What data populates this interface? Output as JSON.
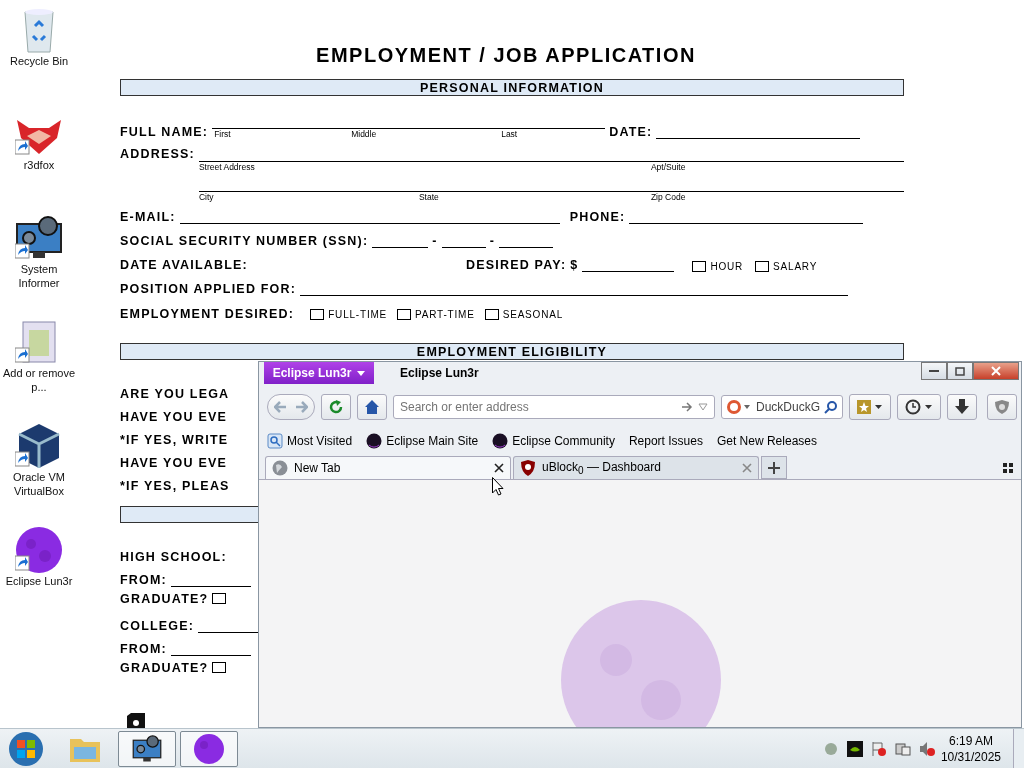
{
  "desktop_icons": [
    {
      "label": "Recycle Bin",
      "kind": "recycle",
      "shortcut": false
    },
    {
      "label": "r3dfox",
      "kind": "fox",
      "shortcut": true
    },
    {
      "label": "System Informer",
      "kind": "monitor",
      "shortcut": true
    },
    {
      "label": "Add or remove p...",
      "kind": "installer",
      "shortcut": true
    },
    {
      "label": "Oracle VM VirtualBox",
      "kind": "cube",
      "shortcut": true
    },
    {
      "label": "Eclipse Lun3r",
      "kind": "moon",
      "shortcut": true
    }
  ],
  "document": {
    "title": "EMPLOYMENT / JOB APPLICATION",
    "personal": {
      "heading": "PERSONAL INFORMATION",
      "full_name_label": "FULL NAME:",
      "name_hints": [
        "First",
        "Middle",
        "Last"
      ],
      "date_label": "DATE:",
      "address_label": "ADDRESS:",
      "address_hints": [
        "Street Address",
        "Apt/Suite"
      ],
      "address_hints_2": [
        "City",
        "State",
        "Zip Code"
      ],
      "email_label": "E-MAIL:",
      "phone_label": "PHONE:",
      "ssn_label": "SOCIAL SECURITY NUMBER (SSN):",
      "ssn_separators": [
        "-",
        "-"
      ],
      "date_available_label": "DATE AVAILABLE:",
      "desired_pay_label": "DESIRED PAY:",
      "currency": "$",
      "pay_options": [
        {
          "label": "HOUR",
          "checked": false
        },
        {
          "label": "SALARY",
          "checked": false
        }
      ],
      "position_label": "POSITION APPLIED FOR:",
      "employment_desired_label": "EMPLOYMENT DESIRED:",
      "employment_options": [
        {
          "label": "FULL-TIME",
          "checked": false
        },
        {
          "label": "PART-TIME",
          "checked": false
        },
        {
          "label": "SEASONAL",
          "checked": false
        }
      ]
    },
    "eligibility": {
      "heading": "EMPLOYMENT ELIGIBILITY",
      "questions": [
        "ARE YOU LEGA",
        "HAVE YOU EVE",
        "*IF YES, WRITE",
        "HAVE YOU EVE",
        "*IF YES, PLEAS"
      ]
    },
    "education": {
      "rows": [
        {
          "kind": "label",
          "label": "HIGH SCHOOL:"
        },
        {
          "kind": "line",
          "label": "FROM:"
        },
        {
          "kind": "check",
          "label": "GRADUATE?",
          "checked": false
        },
        {
          "kind": "line",
          "label": "COLLEGE:"
        },
        {
          "kind": "line",
          "label": "FROM:"
        },
        {
          "kind": "check",
          "label": "GRADUATE?",
          "checked": false
        }
      ]
    }
  },
  "browser": {
    "menu_button": "Eclipse Lun3r",
    "title": "Eclipse Lun3r",
    "address_placeholder": "Search or enter address",
    "search_text": "DuckDuckG",
    "bookmarks": [
      {
        "label": "Most Visited",
        "kind": "folder"
      },
      {
        "label": "Eclipse Main Site",
        "kind": "eclipse"
      },
      {
        "label": "Eclipse Community",
        "kind": "eclipse"
      },
      {
        "label": "Report Issues",
        "kind": "plain"
      },
      {
        "label": "Get New Releases",
        "kind": "plain"
      }
    ],
    "tabs": [
      {
        "label": "New Tab",
        "kind": "globe",
        "selected": true
      },
      {
        "label": "uBlock$_{0}$ — Dashboard",
        "kind": "shield",
        "selected": false
      }
    ]
  },
  "taskbar": {
    "items": [
      {
        "kind": "folder",
        "running": false
      },
      {
        "kind": "monitor",
        "running": true
      },
      {
        "kind": "moon",
        "running": true
      }
    ],
    "time": "6:19 AM",
    "date": "10/31/2025"
  }
}
